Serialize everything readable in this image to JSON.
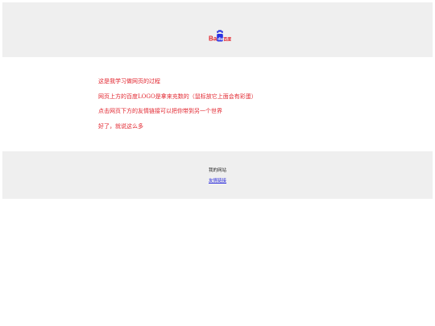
{
  "header": {
    "logo": {
      "text_left": "Bai",
      "text_right": "百度",
      "icon": "baidu-paw-icon",
      "colors": {
        "red": "#e2262f",
        "blue": "#2932e1"
      }
    }
  },
  "content": {
    "lines": [
      "这是我学习做网页的过程",
      "网页上方的百度LOGO是拿来充数的（鼠标放它上面会有彩蛋）",
      "点击网页下方的友情链接可以把你带到另一个世界",
      "好了，就说这么多"
    ],
    "text_color": "#e2262f"
  },
  "footer": {
    "site_name": "我的网站",
    "friend_link": "友情链接",
    "link_color": "#2a2adb"
  }
}
